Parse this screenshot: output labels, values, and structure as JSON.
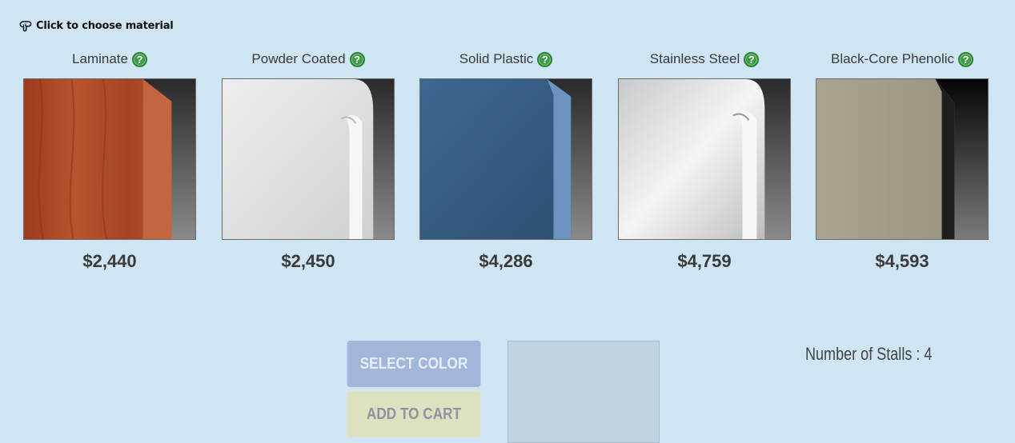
{
  "hint": {
    "text": "Click to choose material",
    "icon": "pointing-hand-icon"
  },
  "materials": [
    {
      "id": "laminate",
      "label": "Laminate",
      "price": "$2,440",
      "face": "#a84a28",
      "edge": "#c8704a"
    },
    {
      "id": "powder-coated",
      "label": "Powder Coated",
      "price": "$2,450",
      "face": "#e2e3e5",
      "edge": "#f4f5f6"
    },
    {
      "id": "solid-plastic",
      "label": "Solid Plastic",
      "price": "$4,286",
      "face": "#3a5f86",
      "edge": "#6f95c0"
    },
    {
      "id": "stainless-steel",
      "label": "Stainless Steel",
      "price": "$4,759",
      "face": "#d9dadc",
      "edge": "#f2f3f4"
    },
    {
      "id": "black-core-phenolic",
      "label": "Black-Core Phenolic",
      "price": "$4,593",
      "face": "#a49f8a",
      "edge": "#2a2a2a"
    }
  ],
  "help_symbol": "?",
  "buttons": {
    "select_color": "SELECT COLOR",
    "add_to_cart": "ADD TO CART"
  },
  "stalls": {
    "text": "Number of Stalls : 4"
  }
}
